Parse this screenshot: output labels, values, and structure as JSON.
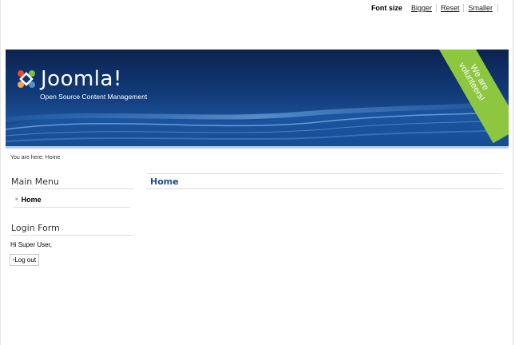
{
  "font_size": {
    "label": "Font size",
    "bigger": "Bigger",
    "reset": "Reset",
    "smaller": "Smaller"
  },
  "header": {
    "logo_text": "Joomla!",
    "tagline": "Open Source Content Management",
    "ribbon_line1": "We are",
    "ribbon_line2": "volunteers!",
    "ribbon_color": "#8dc63f",
    "banner_color": "#123a78"
  },
  "breadcrumb": {
    "text": "You are here: Home"
  },
  "main_menu": {
    "title": "Main Menu",
    "items": [
      {
        "label": "Home"
      }
    ]
  },
  "login_form": {
    "title": "Login Form",
    "greeting": "Hi Super User,",
    "logout_label": "Log out"
  },
  "content": {
    "title": "Home",
    "title_color": "#1b4d88"
  }
}
